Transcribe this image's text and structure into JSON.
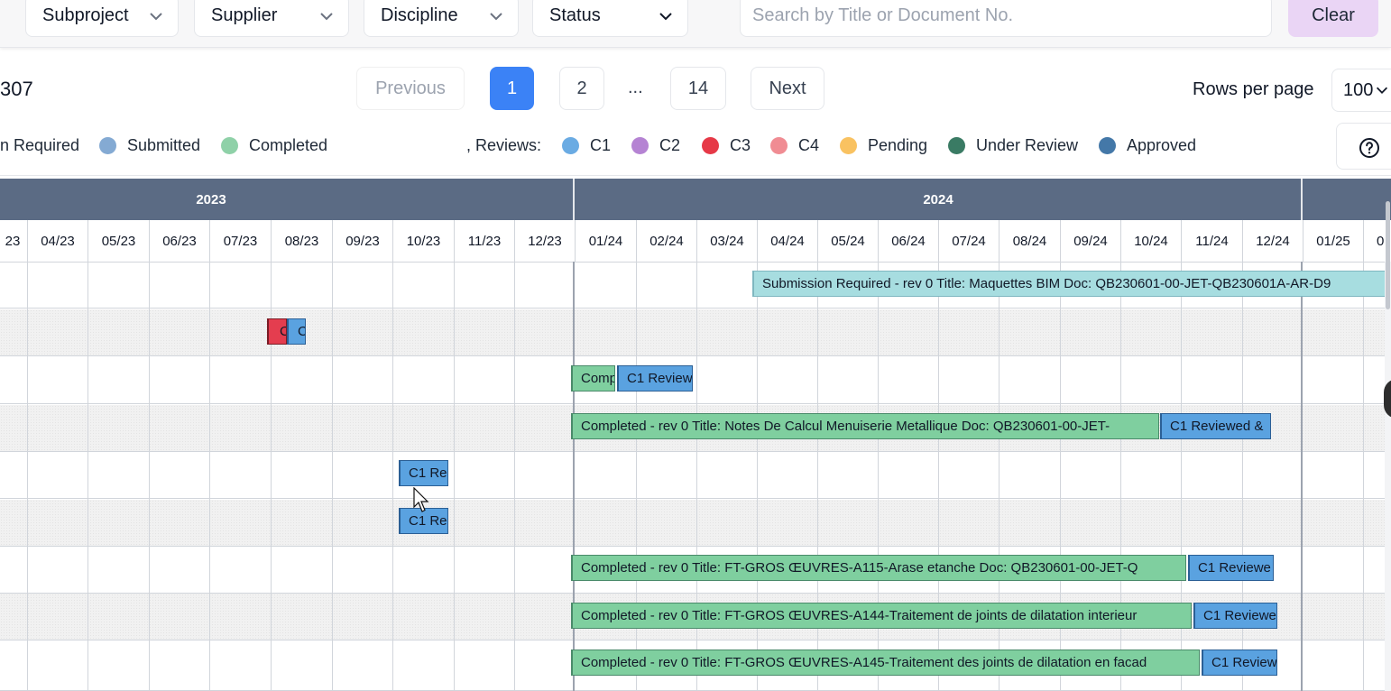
{
  "filters": {
    "subproject": "Subproject",
    "supplier": "Supplier",
    "discipline": "Discipline",
    "status": "Status",
    "search_placeholder": "Search by Title or Document No.",
    "clear_label": "Clear"
  },
  "pagination": {
    "count_text": "307",
    "previous": "Previous",
    "pages": [
      "1",
      "2",
      "14"
    ],
    "ellipsis": "...",
    "next": "Next",
    "current_page": "1",
    "rows_per_page_label": "Rows per page",
    "rows_per_page_value": "100"
  },
  "legend": {
    "status_items": [
      {
        "label": "n Required"
      },
      {
        "label": "Submitted",
        "color": "#84aad3"
      },
      {
        "label": "Completed",
        "color": "#8fd1a8"
      }
    ],
    "reviews_label": ", Reviews:",
    "review_items": [
      {
        "label": "C1",
        "color": "#6aabe3"
      },
      {
        "label": "C2",
        "color": "#b583d3"
      },
      {
        "label": "C3",
        "color": "#e63947"
      },
      {
        "label": "C4",
        "color": "#f08c93"
      },
      {
        "label": "Pending",
        "color": "#f9c261"
      },
      {
        "label": "Under Review",
        "color": "#3a7b64"
      },
      {
        "label": "Approved",
        "color": "#4478a8"
      }
    ]
  },
  "timeline": {
    "years": [
      "2023",
      "2024"
    ],
    "months": [
      "23",
      "04/23",
      "05/23",
      "06/23",
      "07/23",
      "08/23",
      "09/23",
      "10/23",
      "11/23",
      "12/23",
      "01/24",
      "02/24",
      "03/24",
      "04/24",
      "05/24",
      "06/24",
      "07/24",
      "08/24",
      "09/24",
      "10/24",
      "11/24",
      "12/24",
      "01/25",
      "0"
    ]
  },
  "bars": {
    "row1_submission": "Submission Required - rev 0 Title: Maquettes BIM Doc: QB230601-00-JET-QB230601A-AR-D9",
    "row2_c3": "C",
    "row2_c1": "C",
    "row3_completed": "Comp",
    "row3_c1": "C1 Review",
    "row4_completed": "Completed - rev 0 Title: Notes De Calcul Menuiserie Metallique Doc: QB230601-00-JET-",
    "row4_c1": "C1 Reviewed &",
    "row5_c1": "C1 Re",
    "row6_c1": "C1 Re",
    "row7_completed": "Completed - rev 0 Title: FT-GROS ŒUVRES-A115-Arase etanche Doc: QB230601-00-JET-Q",
    "row7_c1": "C1 Reviewe",
    "row8_completed": "Completed - rev 0 Title: FT-GROS ŒUVRES-A144-Traitement de joints de dilatation interieur",
    "row8_c1": "C1 Reviewe",
    "row9_completed": "Completed - rev 0 Title: FT-GROS ŒUVRES-A145-Traitement des joints de dilatation en facad",
    "row9_c1": "C1 Review"
  },
  "colors": {
    "year_header": "#5b6b84",
    "primary": "#3b82f6",
    "clear_button": "#ead5f5"
  }
}
